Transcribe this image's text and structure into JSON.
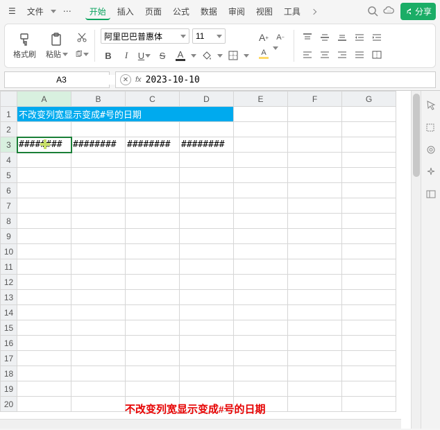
{
  "menubar": {
    "file_label": "文件",
    "tabs": [
      "开始",
      "插入",
      "页面",
      "公式",
      "数据",
      "审阅",
      "视图",
      "工具"
    ],
    "active_tab_index": 0,
    "share_label": "分享"
  },
  "ribbon": {
    "format_painter": "格式刷",
    "paste": "粘贴",
    "font_name": "阿里巴巴普惠体",
    "font_size": "11",
    "bold": "B",
    "italic": "I",
    "underline": "U",
    "strike": "S",
    "font_letter": "A",
    "increase_font": "A",
    "decrease_font": "A"
  },
  "formula": {
    "name_box": "A3",
    "fx": "fx",
    "value": "2023-10-10"
  },
  "sheet": {
    "columns": [
      "A",
      "B",
      "C",
      "D",
      "E",
      "F",
      "G"
    ],
    "selected_col": "A",
    "selected_row": 3,
    "merged_title": "不改变列宽显示变成#号的日期",
    "row3": [
      "########",
      "########",
      "########",
      "########"
    ],
    "footer_caption": "不改变列宽显示变成#号的日期",
    "row_count": 20
  }
}
